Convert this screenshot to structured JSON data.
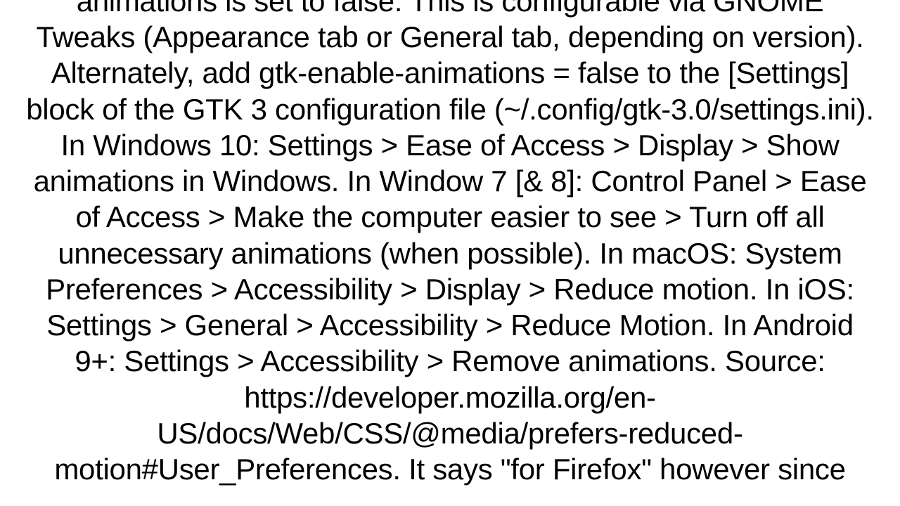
{
  "document": {
    "body": "animations is set to false. This is configurable via GNOME Tweaks (Appearance tab or General tab, depending on version).  Alternately, add gtk-enable-animations = false to the [Settings] block of the GTK 3 configuration file (~/.config/gtk-3.0/settings.ini).   In Windows 10: Settings > Ease of Access > Display > Show animations in Windows. In Window 7 [& 8]: Control Panel > Ease of Access > Make the computer easier to see > Turn off all unnecessary animations (when possible). In macOS: System Preferences > Accessibility > Display > Reduce motion. In iOS: Settings > General > Accessibility > Reduce Motion. In Android 9+: Settings > Accessibility > Remove animations.  Source: https://developer.mozilla.org/en-US/docs/Web/CSS/@media/prefers-reduced-motion#User_Preferences. It says \"for Firefox\" however since"
  }
}
